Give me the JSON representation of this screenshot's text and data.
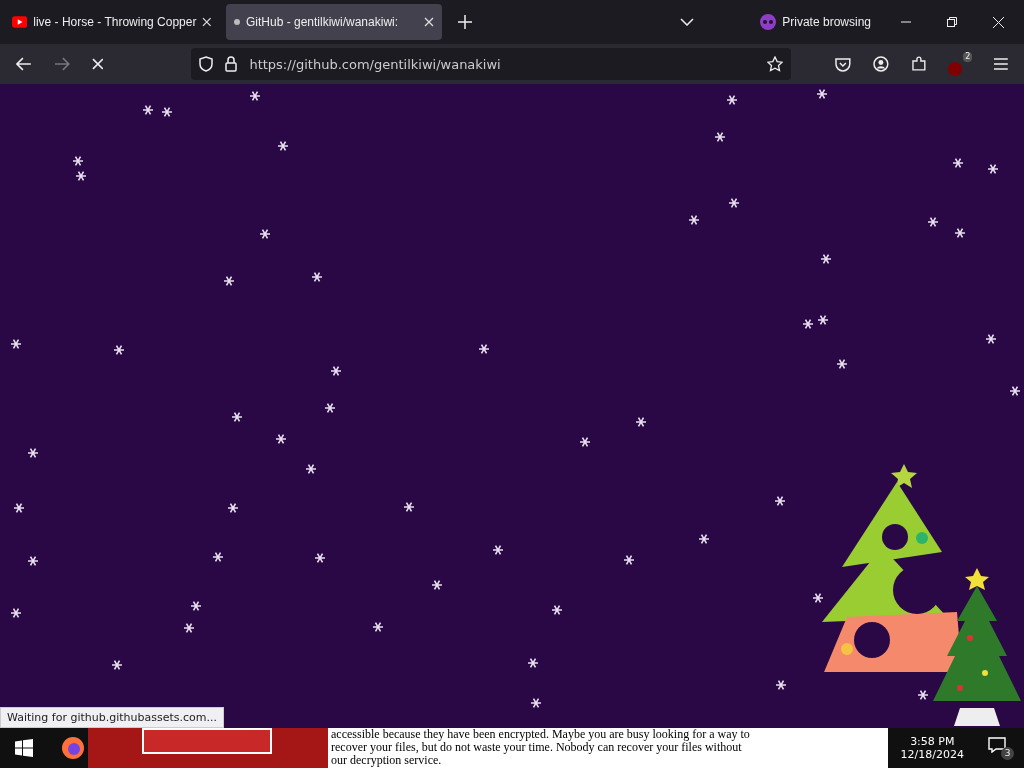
{
  "browser": {
    "tabs": [
      {
        "kind": "video",
        "title": "live - Horse - Throwing Copper",
        "selected": false
      },
      {
        "kind": "loading",
        "title": "GitHub - gentilkiwi/wanakiwi:",
        "selected": true
      }
    ],
    "private_label": "Private browsing",
    "address": {
      "value": "https://github.com/gentilkiwi/wanakiwi"
    },
    "extension_badge": "2",
    "status": "Waiting for github.githubassets.com..."
  },
  "ransom_window": {
    "lines": [
      "accessible because they have been encrypted. Maybe you are busy looking for a way to",
      "recover your files, but do not waste your time. Nobody can recover your files without",
      "our decryption service."
    ]
  },
  "taskbar": {
    "time": "3:58 PM",
    "date": "12/18/2024",
    "notification_count": "3"
  }
}
